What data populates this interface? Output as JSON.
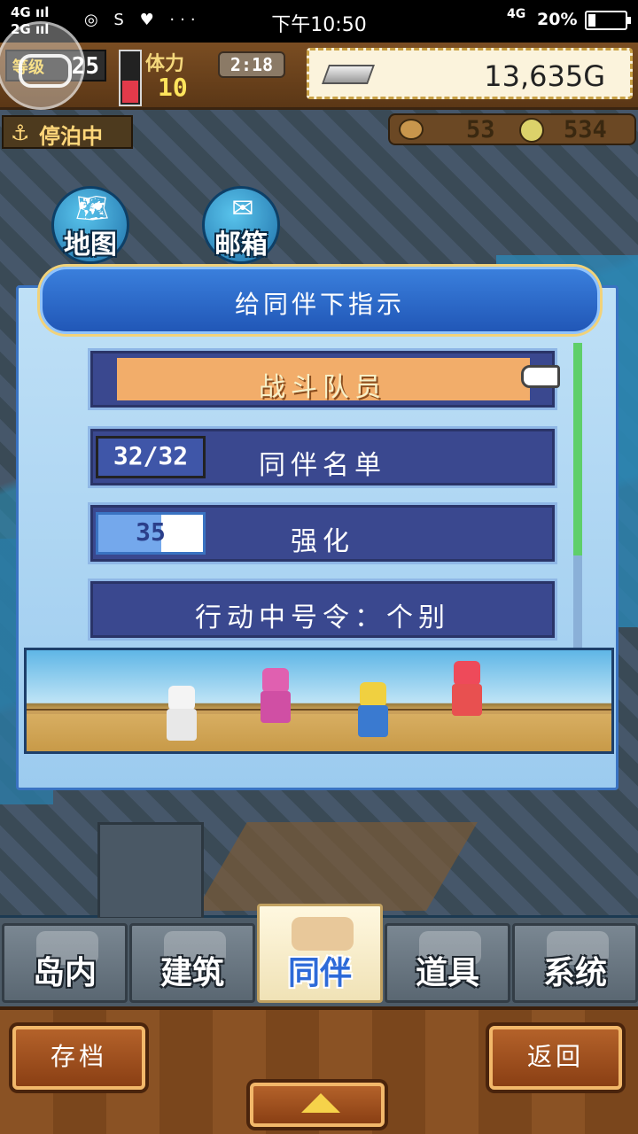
{
  "status_bar": {
    "signal_1": "4G ııl",
    "signal_2": "2G ııl",
    "apps": "◎ S ♥ ···",
    "time": "下午10:50",
    "network": "4G",
    "battery_text": "20%",
    "battery_level": 0.2
  },
  "hud": {
    "level_label": "等级",
    "level_value": "25",
    "stamina_label": "体力",
    "stamina_value": "10",
    "stamina_level": 0.45,
    "timer": "2:18",
    "gold": "13,635G",
    "berth_label": "停泊中",
    "resource_a": "53",
    "resource_b": "534"
  },
  "map_buttons": {
    "map_label": "地图",
    "mail_label": "邮箱"
  },
  "dialog": {
    "title": "给同伴下指示",
    "options": {
      "battle_team": "战斗队员",
      "roster": "同伴名单",
      "roster_count": "32/32",
      "enhance": "强化",
      "enhance_count": "35",
      "enhance_level": 0.6,
      "command": "行动中号令：个别"
    }
  },
  "tabs": [
    {
      "label": "岛内",
      "icon": "house-icon"
    },
    {
      "label": "建筑",
      "icon": "cannon-icon"
    },
    {
      "label": "同伴",
      "icon": "companions-icon"
    },
    {
      "label": "道具",
      "icon": "items-icon"
    },
    {
      "label": "系统",
      "icon": "book-icon"
    }
  ],
  "bottom": {
    "save": "存档",
    "back": "返回"
  },
  "colors": {
    "highlight": "#f2ad6a",
    "dialog_header": "#2157b7",
    "active_tab_text": "#2d6ad8"
  }
}
